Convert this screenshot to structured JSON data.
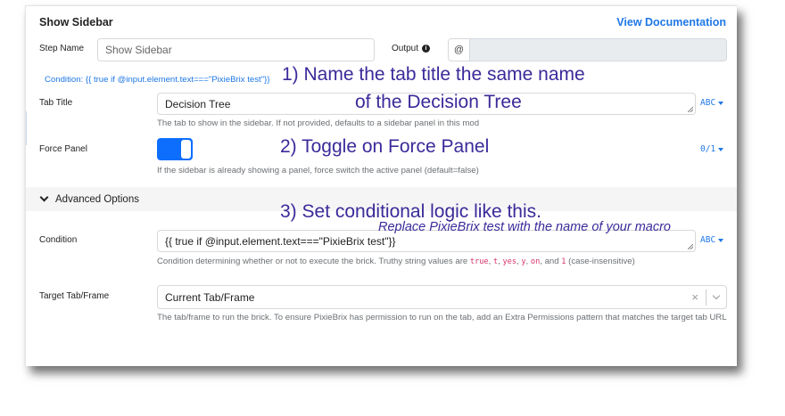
{
  "header": {
    "title": "Show Sidebar",
    "documentation_link": "View Documentation"
  },
  "step_name": {
    "label": "Step Name",
    "value": "Show Sidebar"
  },
  "output": {
    "label": "Output",
    "prefix": "@",
    "value": ""
  },
  "condition_link": "Condition: {{ true if @input.element.text===\"PixieBrix test\"}}",
  "tab_title": {
    "label": "Tab Title",
    "value": "Decision Tree",
    "type": "ABC",
    "help": "The tab to show in the sidebar. If not provided, defaults to a sidebar panel in this mod"
  },
  "force_panel": {
    "label": "Force Panel",
    "toggled": true,
    "type": "0/1",
    "help": "If the sidebar is already showing a panel, force switch the active panel (default=false)"
  },
  "advanced": {
    "label": "Advanced Options"
  },
  "condition": {
    "label": "Condition",
    "value": "{{ true if @input.element.text===\"PixieBrix test\"}}",
    "type": "ABC",
    "help_prefix": "Condition determining whether or not to execute the brick. Truthy string values are",
    "truthy_values": [
      "true",
      "t",
      "yes",
      "y",
      "on"
    ],
    "help_and": "and",
    "one_value": "1",
    "help_suffix": "(case-insensitive)"
  },
  "target_tab": {
    "label": "Target Tab/Frame",
    "value": "Current Tab/Frame",
    "clear": "×",
    "help": "The tab/frame to run the brick. To ensure PixieBrix has permission to run on the tab, add an Extra Permissions pattern that matches the target tab URL"
  },
  "annotations": {
    "step1_line1": "1) Name the tab title the same name",
    "step1_line2": "of the Decision Tree",
    "step2": "2) Toggle on Force Panel",
    "step3": "3) Set conditional logic like this.",
    "step3_note": "Replace PixieBrix test with the name of your macro"
  },
  "colors": {
    "accent": "#1f78e6",
    "toggle_on": "#0d6efd",
    "annotation": "#3a2a9a",
    "code": "#d6336c"
  },
  "icons": {
    "info": "info-icon",
    "caret": "caret-down-icon",
    "chevron": "chevron-down-icon",
    "clear": "clear-icon"
  }
}
